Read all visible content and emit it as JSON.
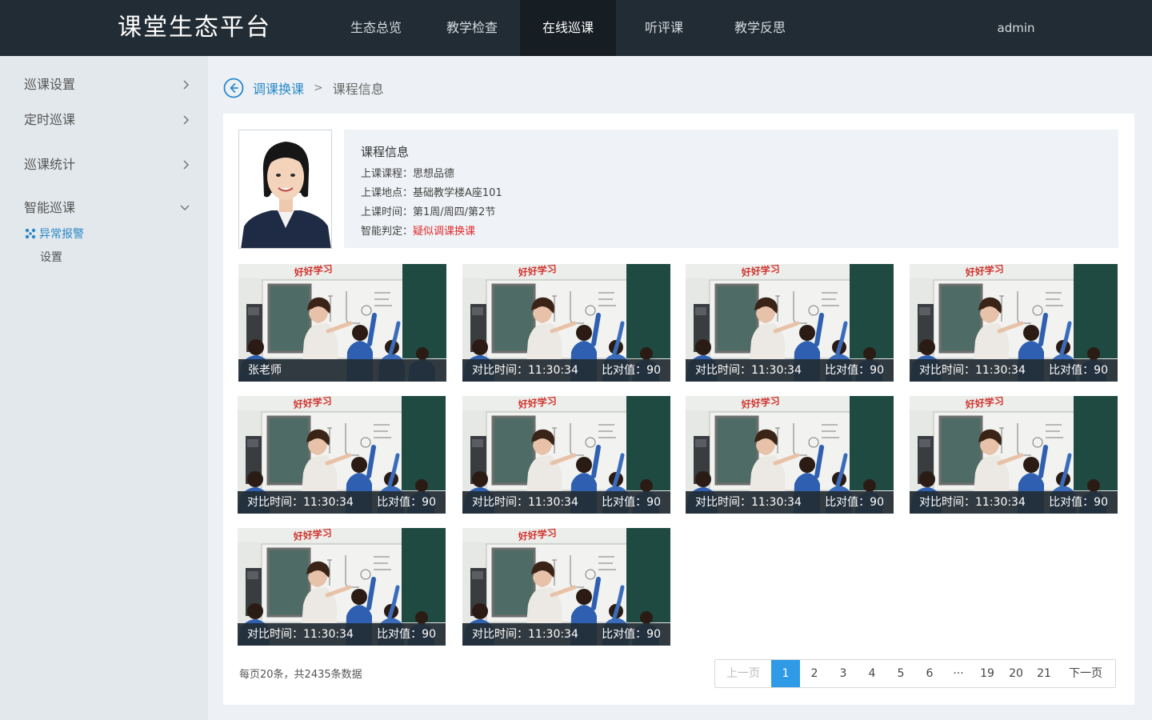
{
  "header": {
    "logo": "课堂生态平台",
    "nav": [
      "生态总览",
      "教学检查",
      "在线巡课",
      "听评课",
      "教学反思"
    ],
    "active_nav": "在线巡课",
    "user": "admin"
  },
  "sidebar": {
    "items": [
      {
        "label": "巡课设置",
        "expanded": false
      },
      {
        "label": "定时巡课",
        "expanded": false
      },
      {
        "label": "巡课统计",
        "expanded": false
      },
      {
        "label": "智能巡课",
        "expanded": true
      }
    ],
    "sub_items": [
      "异常报警",
      "设置"
    ],
    "active_sub": "异常报警"
  },
  "breadcrumb": {
    "parent": "调课换课",
    "separator": ">",
    "current": "课程信息"
  },
  "course_info": {
    "title": "课程信息",
    "lines": [
      {
        "label": "上课课程：",
        "value": "思想品德"
      },
      {
        "label": "上课地点：",
        "value": "基础教学楼A座101"
      },
      {
        "label": "上课时间：",
        "value": "第1周/周四/第2节"
      },
      {
        "label": "智能判定：",
        "value": "疑似调课换课"
      }
    ]
  },
  "thumbnails": {
    "first_caption": "张老师",
    "compare_items": [
      {
        "time": "对比时间：11:30:34",
        "score": "比对值：90"
      },
      {
        "time": "对比时间：11:30:34",
        "score": "比对值：90"
      },
      {
        "time": "对比时间：11:30:34",
        "score": "比对值：90"
      },
      {
        "time": "对比时间：11:30:34",
        "score": "比对值：90"
      },
      {
        "time": "对比时间：11:30:34",
        "score": "比对值：90"
      },
      {
        "time": "对比时间：11:30:34",
        "score": "比对值：90"
      },
      {
        "time": "对比时间：11:30:34",
        "score": "比对值：90"
      },
      {
        "time": "对比时间：11:30:34",
        "score": "比对值：90"
      },
      {
        "time": "对比时间：11:30:34",
        "score": "比对值：90"
      }
    ],
    "banner_text": "好好学习"
  },
  "pagination": {
    "summary": "每页20条，共2435条数据",
    "prev": "上一页",
    "next": "下一页",
    "pages": [
      "1",
      "2",
      "3",
      "4",
      "5",
      "6",
      "···",
      "19",
      "20",
      "21"
    ],
    "current": "1"
  },
  "colors": {
    "topbar": "#222c34",
    "accent": "#2a88c8",
    "alert": "#e02a2a",
    "pager_active": "#2f9ae6"
  }
}
